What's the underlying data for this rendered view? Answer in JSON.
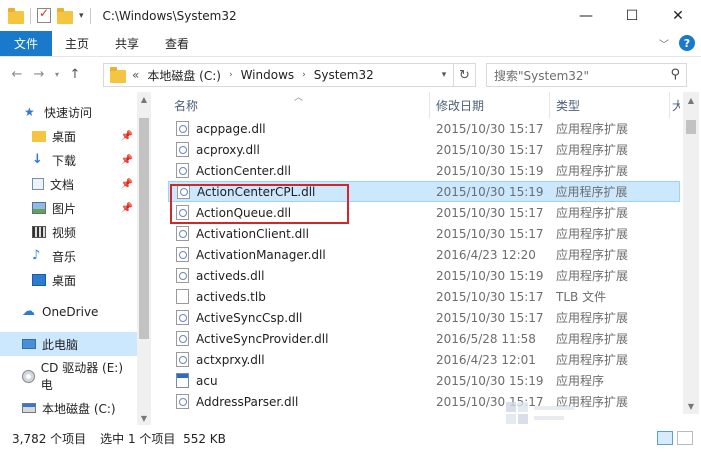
{
  "window": {
    "title": "C:\\Windows\\System32",
    "minimize": "—",
    "maximize": "☐",
    "close": "✕"
  },
  "ribbon": {
    "tabs": [
      "文件",
      "主页",
      "共享",
      "查看"
    ],
    "help": "?"
  },
  "address": {
    "overflow": "«",
    "crumbs": [
      "本地磁盘 (C:)",
      "Windows",
      "System32"
    ],
    "search_placeholder": "搜索\"System32\""
  },
  "nav": {
    "items": [
      {
        "label": "快速访问",
        "icon": "star-icon"
      },
      {
        "label": "桌面",
        "icon": "folder-icon",
        "pinned": true
      },
      {
        "label": "下载",
        "icon": "download-icon",
        "pinned": true
      },
      {
        "label": "文档",
        "icon": "document-icon",
        "pinned": true
      },
      {
        "label": "图片",
        "icon": "picture-icon",
        "pinned": true
      },
      {
        "label": "视频",
        "icon": "video-icon"
      },
      {
        "label": "音乐",
        "icon": "music-icon"
      },
      {
        "label": "桌面",
        "icon": "desktop-icon"
      },
      {
        "label": "OneDrive",
        "icon": "cloud-icon"
      },
      {
        "label": "此电脑",
        "icon": "computer-icon",
        "selected": true
      },
      {
        "label": "CD 驱动器 (E:) 电",
        "icon": "cd-icon"
      },
      {
        "label": "本地磁盘 (C:)",
        "icon": "drive-icon"
      }
    ]
  },
  "columns": {
    "name": "名称",
    "date": "修改日期",
    "type": "类型",
    "size": "大"
  },
  "files": [
    {
      "name": "acppage.dll",
      "date": "2015/10/30 15:17",
      "type": "应用程序扩展",
      "icon": "dll"
    },
    {
      "name": "acproxy.dll",
      "date": "2015/10/30 15:17",
      "type": "应用程序扩展",
      "icon": "dll"
    },
    {
      "name": "ActionCenter.dll",
      "date": "2015/10/30 15:19",
      "type": "应用程序扩展",
      "icon": "dll"
    },
    {
      "name": "ActionCenterCPL.dll",
      "date": "2015/10/30 15:19",
      "type": "应用程序扩展",
      "icon": "dll",
      "selected": true
    },
    {
      "name": "ActionQueue.dll",
      "date": "2015/10/30 15:17",
      "type": "应用程序扩展",
      "icon": "dll"
    },
    {
      "name": "ActivationClient.dll",
      "date": "2015/10/30 15:17",
      "type": "应用程序扩展",
      "icon": "dll"
    },
    {
      "name": "ActivationManager.dll",
      "date": "2016/4/23 12:20",
      "type": "应用程序扩展",
      "icon": "dll"
    },
    {
      "name": "activeds.dll",
      "date": "2015/10/30 15:19",
      "type": "应用程序扩展",
      "icon": "dll"
    },
    {
      "name": "activeds.tlb",
      "date": "2015/10/30 15:17",
      "type": "TLB 文件",
      "icon": "blank"
    },
    {
      "name": "ActiveSyncCsp.dll",
      "date": "2015/10/30 15:17",
      "type": "应用程序扩展",
      "icon": "dll"
    },
    {
      "name": "ActiveSyncProvider.dll",
      "date": "2016/5/28 11:58",
      "type": "应用程序扩展",
      "icon": "dll"
    },
    {
      "name": "actxprxy.dll",
      "date": "2016/4/23 12:01",
      "type": "应用程序扩展",
      "icon": "dll"
    },
    {
      "name": "acu",
      "date": "2015/10/30 15:19",
      "type": "应用程序",
      "icon": "exe"
    },
    {
      "name": "AddressParser.dll",
      "date": "2015/10/30 15:17",
      "type": "应用程序扩展",
      "icon": "dll"
    }
  ],
  "status": {
    "count": "3,782 个项目",
    "selection": "选中 1 个项目  552 KB"
  },
  "colors": {
    "accent": "#1979ca",
    "selection": "#cce8ff",
    "highlight_box": "#d3262b"
  }
}
